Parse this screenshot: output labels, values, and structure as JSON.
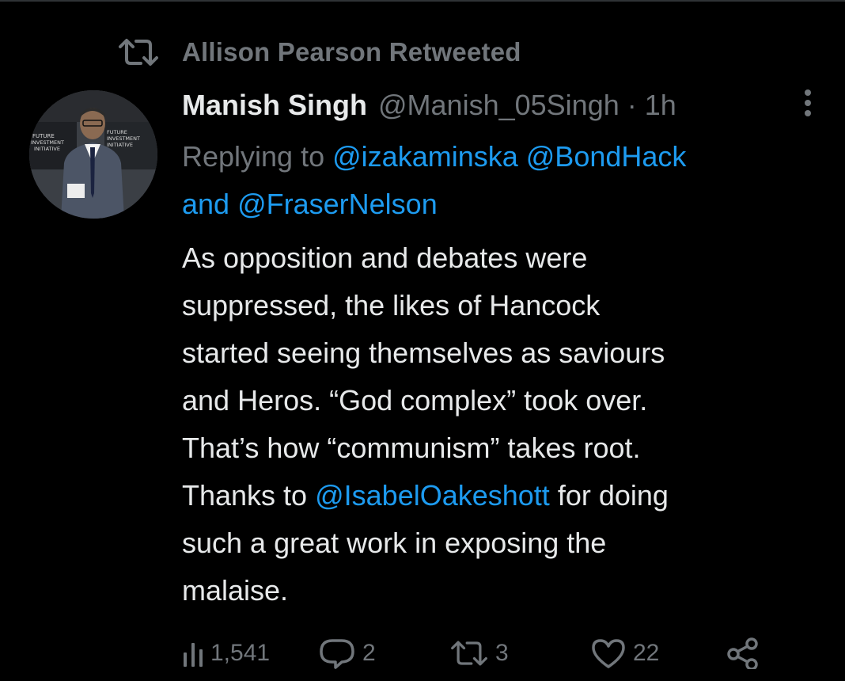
{
  "retweet_context": {
    "label": "Allison Pearson Retweeted",
    "icon": "retweet-icon"
  },
  "tweet": {
    "author": {
      "display_name": "Manish Singh",
      "handle": "@Manish_05Singh",
      "avatar_icon": "avatar-photo",
      "avatar_text": [
        "FUTURE INVESTMENT INITIATIVE",
        "FUTURE INVESTMENT INITIATIVE"
      ]
    },
    "separator": "·",
    "time": "1h",
    "more_icon": "more-vertical-icon",
    "replying_to": {
      "prefix": "Replying to",
      "mentions": [
        "@izakaminska",
        "@BondHack",
        "@FraserNelson"
      ],
      "joiner": "and"
    },
    "body": {
      "line1": "As opposition and debates were",
      "line2": "suppressed, the likes of Hancock",
      "line3": "started seeing themselves as saviours",
      "line4": "and Heros. “God complex” took over.",
      "line5": "That’s how “communism” takes root.",
      "line6_prefix": "Thanks to",
      "line6_mention": "@IsabelOakeshott",
      "line6_suffix": "for doing",
      "line7": "such a great work in exposing the",
      "line8": "malaise."
    },
    "actions": {
      "views": {
        "icon": "views-icon",
        "count": "1,541"
      },
      "replies": {
        "icon": "reply-icon",
        "count": "2"
      },
      "retweets": {
        "icon": "retweet-icon",
        "count": "3"
      },
      "likes": {
        "icon": "heart-icon",
        "count": "22"
      },
      "share": {
        "icon": "share-icon"
      }
    }
  },
  "colors": {
    "background": "#000000",
    "primary_text": "#e7e9ea",
    "secondary_text": "#71767b",
    "link": "#1d9bf0"
  }
}
